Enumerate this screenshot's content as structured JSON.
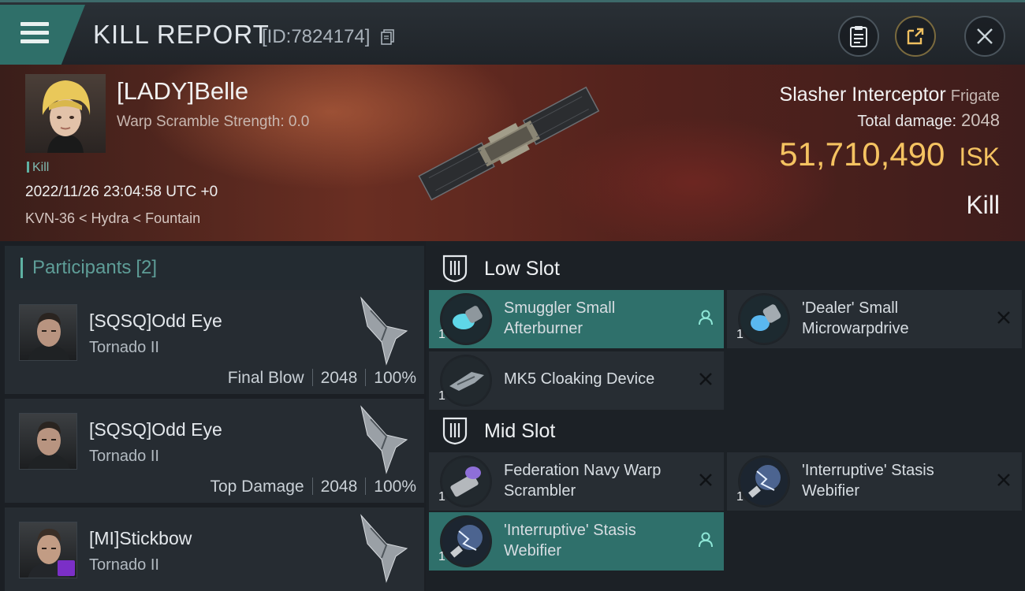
{
  "header": {
    "title": "KILL REPORT",
    "report_id": "[ID:7824174]"
  },
  "victim": {
    "pilot_name": "[LADY]Belle",
    "warp_scramble": "Warp Scramble Strength: 0.0",
    "kill_tag": "Kill",
    "datetime": "2022/11/26 23:04:58 UTC +0",
    "location": "KVN-36 < Hydra < Fountain",
    "ship_name": "Slasher Interceptor",
    "ship_class": "Frigate",
    "total_damage_label": "Total damage:",
    "total_damage": "2048",
    "isk_value": "51,710,490",
    "isk_unit": "ISK",
    "result": "Kill"
  },
  "participants": {
    "title": "Participants",
    "count": "[2]",
    "list": [
      {
        "name": "[SQSQ]Odd Eye",
        "ship": "Tornado II",
        "role": "Final Blow",
        "damage": "2048",
        "percent": "100%"
      },
      {
        "name": "[SQSQ]Odd Eye",
        "ship": "Tornado II",
        "role": "Top Damage",
        "damage": "2048",
        "percent": "100%"
      },
      {
        "name": "[MI]Stickbow",
        "ship": "Tornado II"
      }
    ]
  },
  "slots": {
    "low": {
      "title": "Low Slot",
      "modules": [
        {
          "name": "Smuggler Small Afterburner",
          "qty": "1",
          "state": "dropped"
        },
        {
          "name": "'Dealer' Small Microwarpdrive",
          "qty": "1",
          "state": "destroyed"
        },
        {
          "name": "MK5 Cloaking Device",
          "qty": "1",
          "state": "destroyed"
        }
      ]
    },
    "mid": {
      "title": "Mid Slot",
      "modules": [
        {
          "name": "Federation Navy Warp Scrambler",
          "qty": "1",
          "state": "destroyed"
        },
        {
          "name": "'Interruptive' Stasis Webifier",
          "qty": "1",
          "state": "destroyed"
        },
        {
          "name": "'Interruptive' Stasis Webifier",
          "qty": "1",
          "state": "dropped"
        }
      ]
    }
  },
  "colors": {
    "accent": "#2f706b",
    "isk": "#f5c361",
    "panel": "#272d33"
  }
}
